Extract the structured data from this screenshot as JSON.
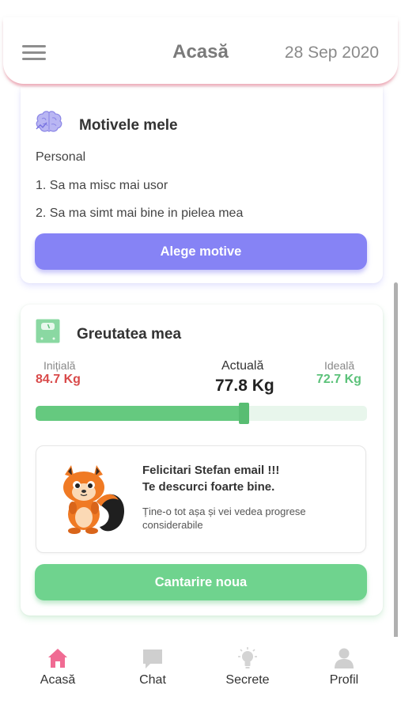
{
  "header": {
    "title": "Acasă",
    "date": "28 Sep 2020"
  },
  "reasons": {
    "title": "Motivele mele",
    "category": "Personal",
    "items": [
      "1. Sa ma misc mai usor",
      "2. Sa ma simt mai bine in pielea mea"
    ],
    "button_label": "Alege motive"
  },
  "weight": {
    "title": "Greutatea mea",
    "initial_label": "Inițială",
    "initial_value": "84.7 Kg",
    "current_label": "Actuală",
    "current_value": "77.8 Kg",
    "ideal_label": "Ideală",
    "ideal_value": "72.7 Kg",
    "progress": 0.63,
    "congrats_line1": "Felicitari Stefan email !!!",
    "congrats_line2": "Te descurci foarte bine.",
    "congrats_sub": "Ține-o tot așa și vei vedea progrese considerabile",
    "button_label": "Cantarire noua"
  },
  "nav": {
    "items": [
      {
        "label": "Acasă",
        "icon": "home-icon",
        "active": true
      },
      {
        "label": "Chat",
        "icon": "chat-icon",
        "active": false
      },
      {
        "label": "Secrete",
        "icon": "lightbulb-icon",
        "active": false
      },
      {
        "label": "Profil",
        "icon": "user-icon",
        "active": false
      }
    ]
  },
  "colors": {
    "accent_pink": "#f06b93",
    "purple": "#8683f5",
    "green": "#6fd38e",
    "initial_red": "#d94a4a",
    "ideal_green": "#5cc27a"
  }
}
